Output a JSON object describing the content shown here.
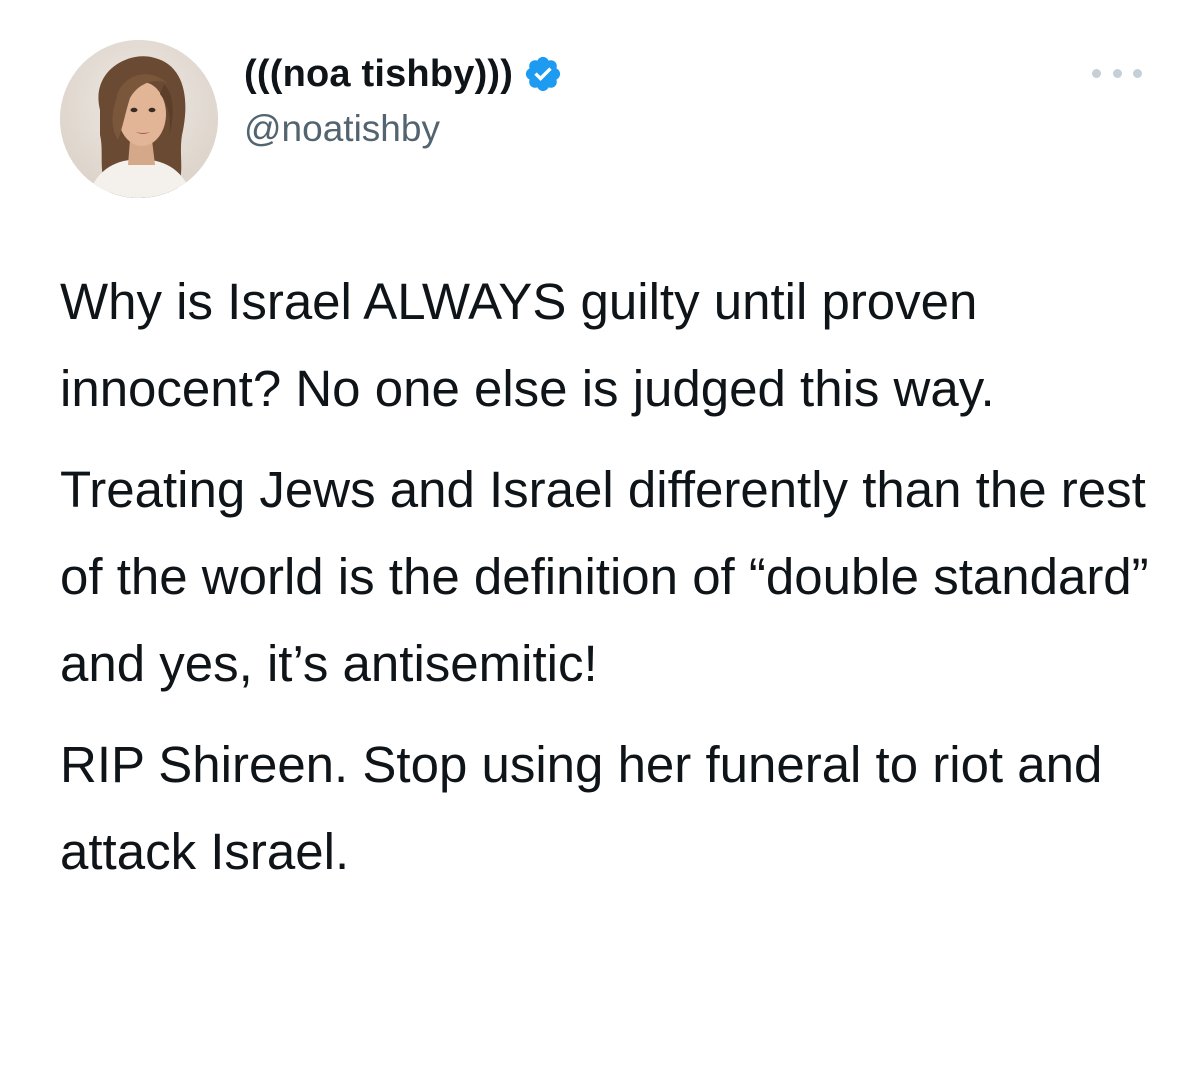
{
  "author": {
    "display_name": "(((noa tishby)))",
    "handle": "@noatishby",
    "verified": true,
    "avatar_icon": "profile-photo"
  },
  "actions": {
    "more_icon": "more-horizontal-icon"
  },
  "tweet": {
    "paragraphs": [
      "Why is Israel ALWAYS guilty until proven innocent? No one else is judged this way.",
      "Treating Jews and Israel differently than the rest of the world is the definition of “double standard” and yes, it’s antisemitic!",
      "RIP Shireen. Stop using her funeral to riot and attack Israel."
    ]
  },
  "colors": {
    "text": "#0f1419",
    "secondary_text": "#536471",
    "verified_badge": "#1d9bf0",
    "more_dots": "#c4cfd6"
  }
}
